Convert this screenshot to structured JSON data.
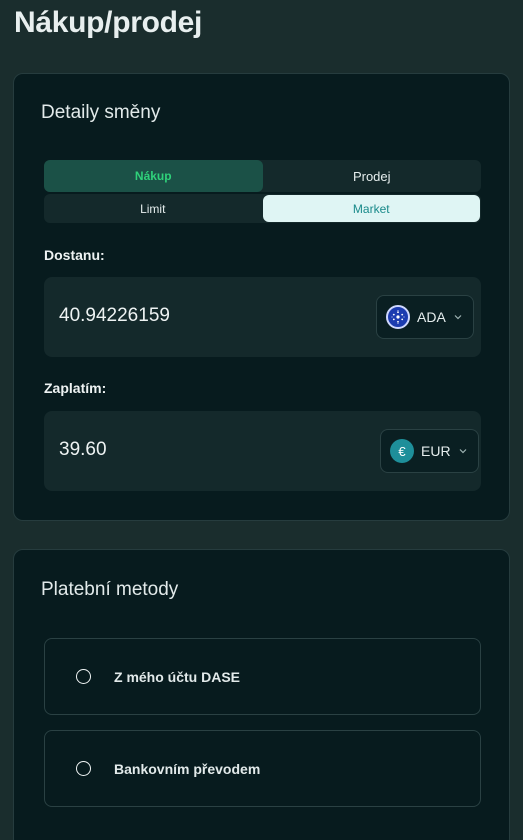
{
  "page": {
    "title": "Nákup/prodej"
  },
  "exchange": {
    "title": "Detaily směny",
    "side_tabs": [
      {
        "label": "Nákup",
        "active": true
      },
      {
        "label": "Prodej",
        "active": false
      }
    ],
    "order_tabs": [
      {
        "label": "Limit",
        "active": false
      },
      {
        "label": "Market",
        "active": true
      }
    ],
    "receive": {
      "label": "Dostanu:",
      "value": "40.94226159",
      "currency": {
        "code": "ADA",
        "icon": "cardano-icon"
      }
    },
    "pay": {
      "label": "Zaplatím:",
      "value": "39.60",
      "currency": {
        "code": "EUR",
        "icon": "euro-icon",
        "symbol": "€"
      }
    }
  },
  "payment": {
    "title": "Platební metody",
    "options": [
      {
        "label": "Z mého účtu DASE",
        "selected": false
      },
      {
        "label": "Bankovním převodem",
        "selected": false
      }
    ]
  },
  "colors": {
    "background": "#1a2d2d",
    "card": "#071b1e",
    "accent_green": "#2fd17a",
    "accent_teal": "#198a8a"
  }
}
